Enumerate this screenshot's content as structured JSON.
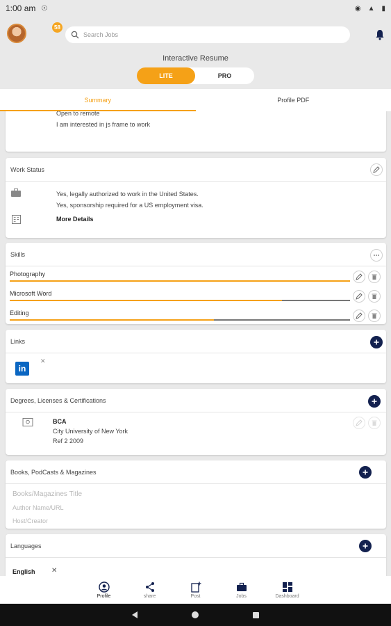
{
  "status_bar": {
    "time": "1:00 am",
    "icons": [
      "data-saver-icon",
      "eye-icon",
      "wifi-icon",
      "battery-icon"
    ]
  },
  "header": {
    "notification_count": "58",
    "search_placeholder": "Search Jobs"
  },
  "resume": {
    "title": "Interactive Resume",
    "toggle": {
      "lite": "LITE",
      "pro": "PRO",
      "selected": "LITE"
    }
  },
  "tabs": [
    {
      "label": "Summary",
      "active": true
    },
    {
      "label": "Profile PDF",
      "active": false
    }
  ],
  "summary_card": {
    "lines": [
      "Open to remote",
      "I am interested in js frame to work"
    ]
  },
  "work_status": {
    "title": "Work Status",
    "lines": [
      "Yes, legally authorized to work in the United States.",
      "Yes, sponsorship required for a US employment visa."
    ],
    "more": "More Details"
  },
  "skills": {
    "title": "Skills",
    "items": [
      {
        "name": "Photography",
        "level": 1.0
      },
      {
        "name": "Microsoft Word",
        "level": 0.8
      },
      {
        "name": "Editing",
        "level": 0.6
      }
    ]
  },
  "links": {
    "title": "Links",
    "items": [
      {
        "icon": "linkedin-icon"
      }
    ]
  },
  "degrees": {
    "title": "Degrees, Licenses & Certifications",
    "item": {
      "degree": "BCA",
      "school": "City University of New York",
      "ref": "Ref 2 2009"
    }
  },
  "books": {
    "title": "Books, PodCasts & Magazines",
    "placeholders": [
      "Books/Magazines Title",
      "Author Name/URL",
      "Host/Creator"
    ]
  },
  "languages": {
    "title": "Languages",
    "items": [
      "English"
    ]
  },
  "bottom_nav": [
    {
      "label": "Profile",
      "icon": "profile-icon",
      "active": true
    },
    {
      "label": "share",
      "icon": "share-icon",
      "active": false
    },
    {
      "label": "Post",
      "icon": "post-icon",
      "active": false
    },
    {
      "label": "Jobs",
      "icon": "briefcase-icon",
      "active": false
    },
    {
      "label": "Dashboard",
      "icon": "dashboard-icon",
      "active": false
    }
  ],
  "colors": {
    "accent": "#f5a117",
    "navy": "#13214f",
    "background": "#e9e9e9"
  }
}
